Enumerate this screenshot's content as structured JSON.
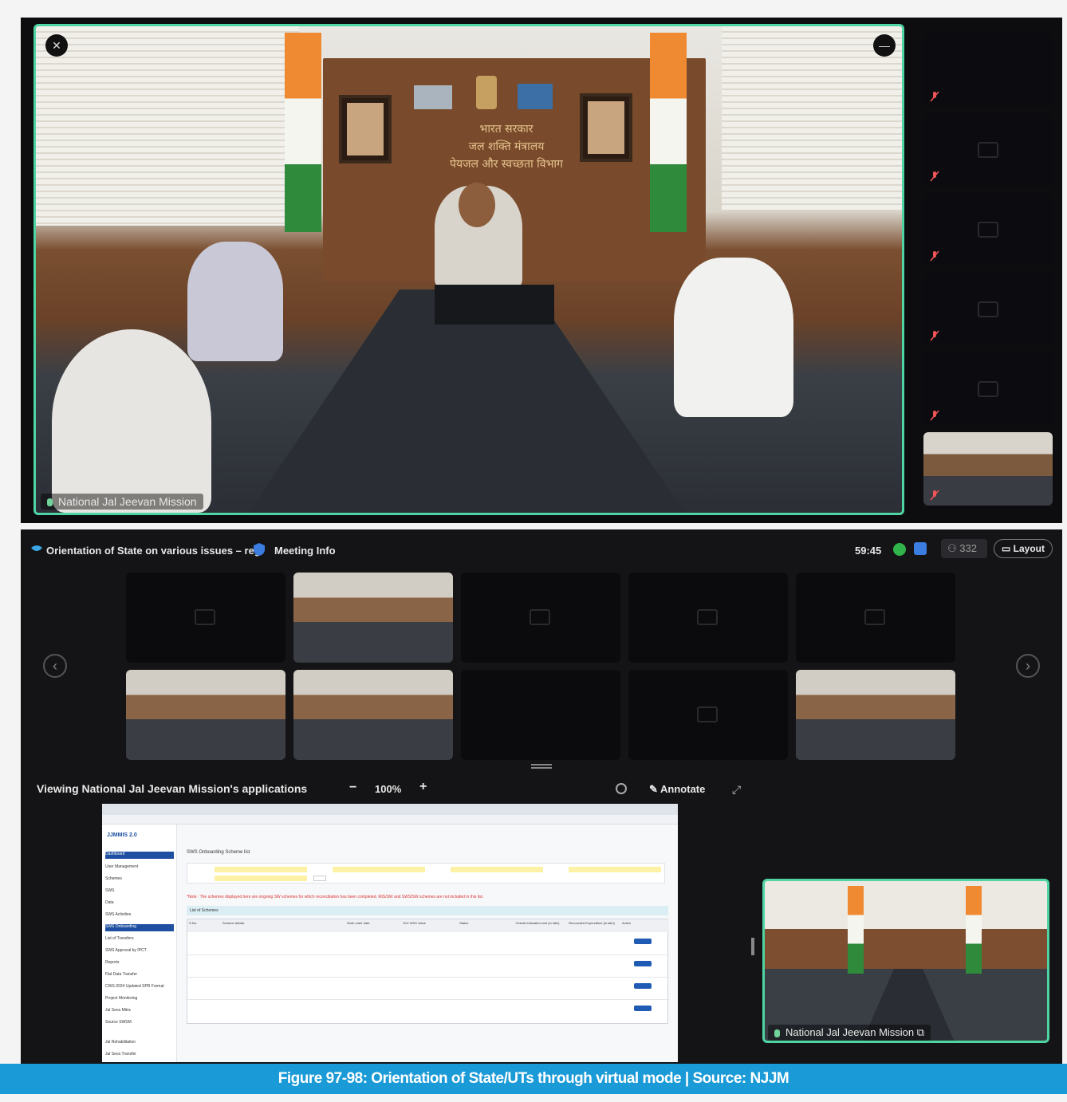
{
  "top_call": {
    "main_participant_name": "National Jal Jeevan Mission",
    "room_signage": [
      "भारत सरकार",
      "जल शक्ति मंत्रालय",
      "पेयजल और स्वच्छता विभाग"
    ]
  },
  "meeting_bar": {
    "title": "Orientation of State on various issues – reg.",
    "info_label": "Meeting Info",
    "timer": "59:45",
    "participant_count": "332",
    "layout_label": "Layout"
  },
  "share_bar": {
    "viewing_label": "Viewing National Jal Jeevan Mission's applications",
    "zoom_minus": "−",
    "zoom_level": "100%",
    "zoom_plus": "+",
    "annotate_label": "Annotate"
  },
  "shared_app": {
    "logo_text": "JJMMIS 2.0",
    "page_heading": "SWS Onboarding Scheme list",
    "notice": "*Note : The schemes displayed here are ongoing SW schemes for which reconciliation has been completed. MIS/SW and SWS/SW schemes are not included in this list.",
    "section_label": "List of Schemes",
    "sidebar_items": [
      "Dashboard",
      "User Management",
      "Schemes",
      "SWS",
      "Data",
      "SWS Activities",
      "SWS Onboarding",
      "List of Transfers",
      "SWS Approval by IPCT",
      "Reports",
      "Flat Data Transfer",
      "CWS-2024 Updated SPR Format",
      "Project Monitoring",
      "Jal Seva Mitra",
      "Source SWSM",
      "Jal Rehabilitation",
      "Jal Seva Transfer"
    ],
    "columns": [
      "S.No.",
      "Scheme details",
      "Work order date",
      "DO/ WSS Value",
      "Status",
      "Overall estimated cost (in lakh)",
      "Reconciled Expenditure (in lakh)",
      "Action"
    ],
    "row_count_visible": 4,
    "action_label": "Details"
  },
  "self_view": {
    "name": "National Jal Jeevan Mission"
  },
  "caption": {
    "text": "Figure 97-98: Orientation of State/UTs through virtual mode  |  Source: NJJM"
  },
  "colors": {
    "active_border": "#4fd4a3",
    "caption_bg": "#1a9ad6",
    "app_primary": "#1e4fa0"
  }
}
